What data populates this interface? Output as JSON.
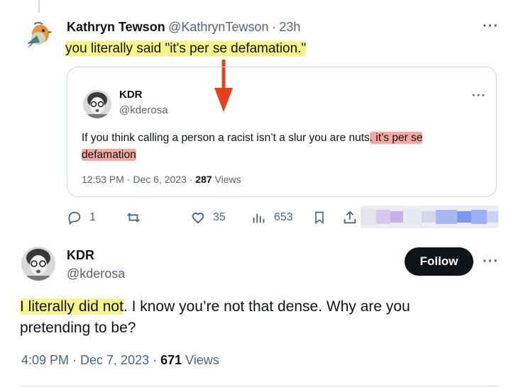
{
  "parent_tweet": {
    "author_name": "Kathryn Tewson",
    "author_handle": "@KathrynTewson",
    "separator": "·",
    "time": "23h",
    "text": "you literally said \"it's per se defamation.\"",
    "more_icon": "more-horizontal-icon",
    "quoted": {
      "author_name": "KDR",
      "author_handle": "@kderosa",
      "text_plain": "If you think calling a person a racist isn’t a slur you are nuts",
      "text_hl1": ". it’s per se",
      "text_hl2": "defamation",
      "timestamp": "12:53 PM · Dec 6, 2023 · ",
      "views_count": "287",
      "views_label": "Views"
    },
    "actions": {
      "replies": "1",
      "reposts": "",
      "likes": "35",
      "views": "653"
    }
  },
  "reply_tweet": {
    "author_name": "KDR",
    "author_handle": "@kderosa",
    "follow_label": "Follow",
    "text_highlight": "I literally did not",
    "text_rest": ". I know you’re not that dense. Why are you pretending to be?",
    "timestamp": "4:09 PM · Dec 7, 2023 · ",
    "views_count": "671",
    "views_label": "Views"
  },
  "colors": {
    "accent_dark": "#0f1419",
    "secondary_text": "#536471",
    "highlight_yellow": "#f7f58a",
    "highlight_pink": "#f4a8a0",
    "annotation_arrow": "#e8401c"
  }
}
